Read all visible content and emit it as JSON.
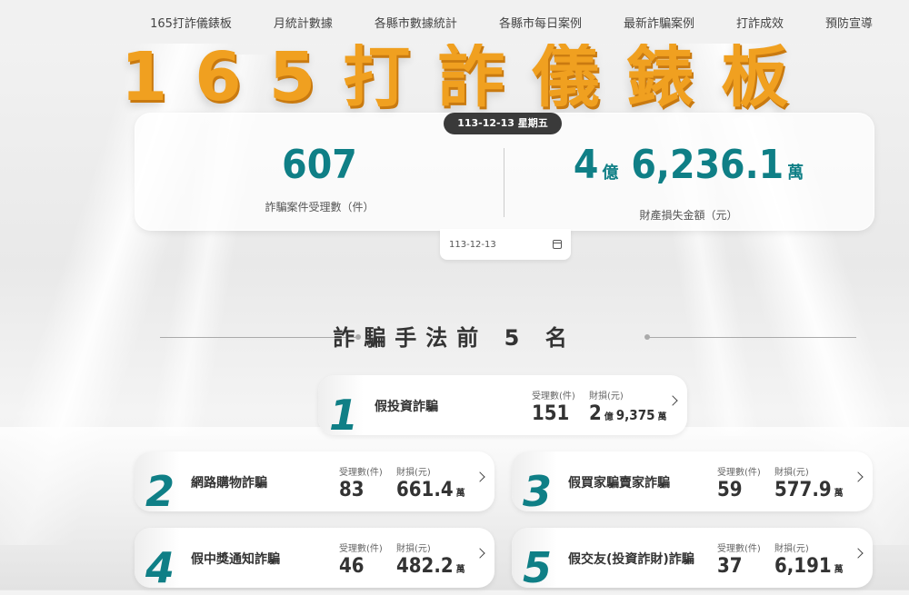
{
  "nav": [
    "165打詐儀錶板",
    "月統計數據",
    "各縣市數據統計",
    "各縣市每日案例",
    "最新詐騙案例",
    "打詐成效",
    "預防宣導"
  ],
  "title": "165打詐儀錶板",
  "date": "113-12-13 星期五",
  "summary": {
    "cases": "607",
    "cases_label": "詐騙案件受理數（件）",
    "loss_yi": "4",
    "loss_yi_unit": "億",
    "loss_wan": "6,236.1",
    "loss_wan_unit": "萬",
    "loss_label": "財產損失金額（元）"
  },
  "date_input": "113-12-13",
  "section_title": "詐騙手法前 5 名",
  "stat_labels": {
    "cases": "受理數(件)",
    "loss": "財損(元)"
  },
  "top5": [
    {
      "rank": "1",
      "name": "假投資詐騙",
      "cases": "151",
      "loss_main": "2",
      "loss_main_unit": "億",
      "loss_sub": "9,375",
      "loss_sub_unit": "萬"
    },
    {
      "rank": "2",
      "name": "網路購物詐騙",
      "cases": "83",
      "loss_main": "661.4",
      "loss_main_unit": "萬",
      "loss_sub": "",
      "loss_sub_unit": ""
    },
    {
      "rank": "3",
      "name": "假買家騙賣家詐騙",
      "cases": "59",
      "loss_main": "577.9",
      "loss_main_unit": "萬",
      "loss_sub": "",
      "loss_sub_unit": ""
    },
    {
      "rank": "4",
      "name": "假中獎通知詐騙",
      "cases": "46",
      "loss_main": "482.2",
      "loss_main_unit": "萬",
      "loss_sub": "",
      "loss_sub_unit": ""
    },
    {
      "rank": "5",
      "name": "假交友(投資詐財)詐騙",
      "cases": "37",
      "loss_main": "6,191",
      "loss_main_unit": "萬",
      "loss_sub": "",
      "loss_sub_unit": ""
    }
  ]
}
